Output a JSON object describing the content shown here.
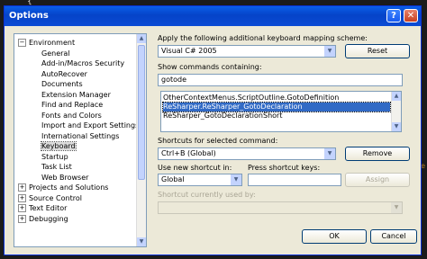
{
  "window": {
    "title": "Options"
  },
  "tree": {
    "items": [
      {
        "label": "Environment",
        "expander": "−"
      },
      {
        "label": "General"
      },
      {
        "label": "Add-in/Macros Security"
      },
      {
        "label": "AutoRecover"
      },
      {
        "label": "Documents"
      },
      {
        "label": "Extension Manager"
      },
      {
        "label": "Find and Replace"
      },
      {
        "label": "Fonts and Colors"
      },
      {
        "label": "Import and Export Settings"
      },
      {
        "label": "International Settings"
      },
      {
        "label": "Keyboard"
      },
      {
        "label": "Startup"
      },
      {
        "label": "Task List"
      },
      {
        "label": "Web Browser"
      },
      {
        "label": "Projects and Solutions",
        "expander": "+"
      },
      {
        "label": "Source Control",
        "expander": "+"
      },
      {
        "label": "Text Editor",
        "expander": "+"
      },
      {
        "label": "Debugging",
        "expander": "+"
      }
    ]
  },
  "mapping": {
    "label": "Apply the following additional keyboard mapping scheme:",
    "selected": "Visual C# 2005",
    "reset_label": "Reset"
  },
  "commands": {
    "label": "Show commands containing:",
    "filter_value": "gotode",
    "items": [
      "OtherContextMenus.ScriptOutline.GotoDefinition",
      "ReSharper.ReSharper_GotoDeclaration",
      "ReSharper_GotoDeclarationShort"
    ]
  },
  "shortcuts": {
    "label": "Shortcuts for selected command:",
    "selected": "Ctrl+B (Global)",
    "remove_label": "Remove"
  },
  "new_shortcut": {
    "use_in_label": "Use new shortcut in:",
    "use_in_value": "Global",
    "press_label": "Press shortcut keys:",
    "press_value": "",
    "assign_label": "Assign"
  },
  "currently_used": {
    "label": "Shortcut currently used by:",
    "value": ""
  },
  "footer": {
    "ok_label": "OK",
    "cancel_label": "Cancel"
  },
  "background": {
    "top_glyph": "{",
    "side_text": "me"
  }
}
